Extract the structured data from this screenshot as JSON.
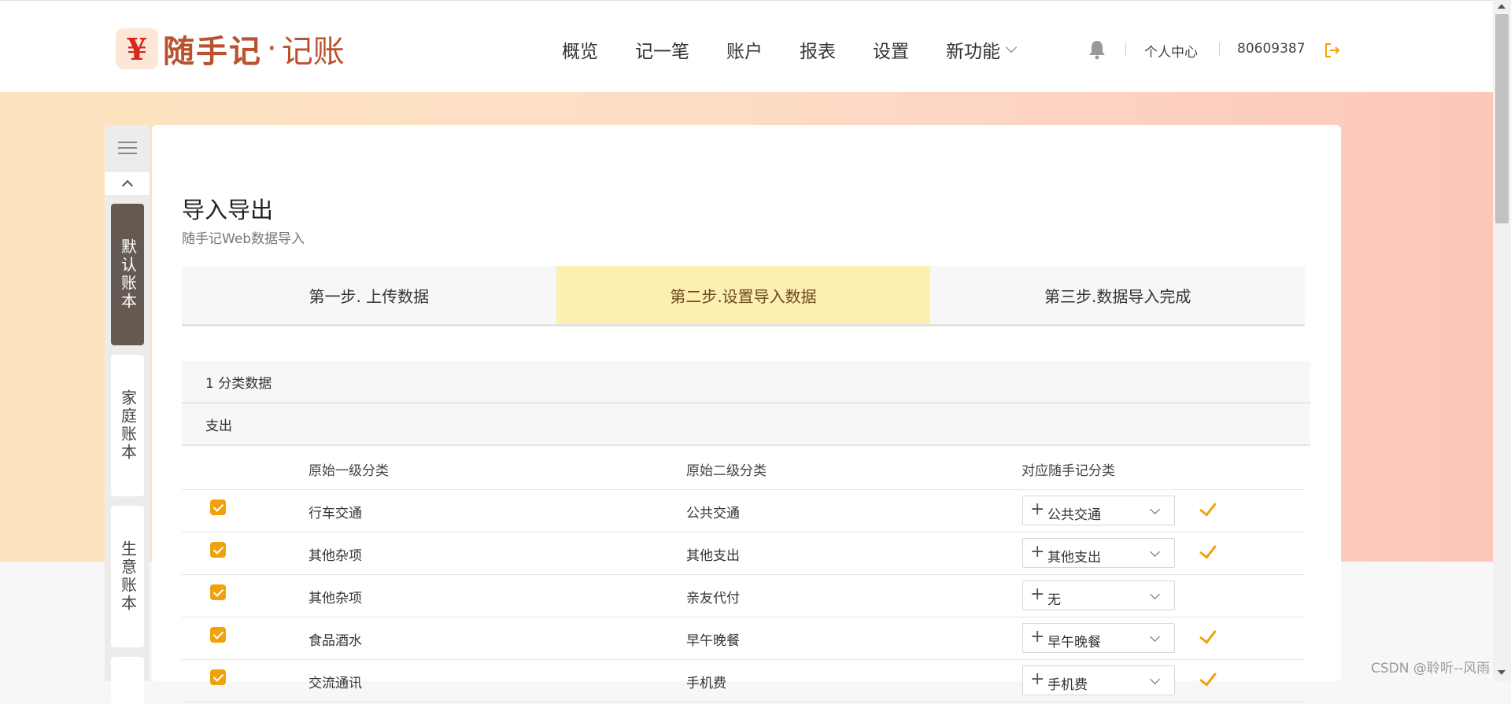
{
  "header": {
    "logo_glyph": "¥",
    "logo_name": "随手记",
    "logo_dot": "·",
    "logo_sub": "记账",
    "nav": [
      "概览",
      "记一笔",
      "账户",
      "报表",
      "设置",
      "新功能"
    ],
    "user_center": "个人中心",
    "user_id": "80609387"
  },
  "sidebar": {
    "books": [
      "默认账本",
      "家庭账本",
      "生意账本"
    ],
    "active_index": 0
  },
  "page": {
    "title": "导入导出",
    "subtitle": "随手记Web数据导入"
  },
  "steps": [
    "第一步. 上传数据",
    "第二步.设置导入数据",
    "第三步.数据导入完成"
  ],
  "active_step": 1,
  "section": {
    "heading": "1 分类数据",
    "type": "支出"
  },
  "table": {
    "headers": [
      "原始一级分类",
      "原始二级分类",
      "对应随手记分类"
    ],
    "rows": [
      {
        "level1": "行车交通",
        "level2": "公共交通",
        "mapped": "公共交通",
        "matched": true
      },
      {
        "level1": "其他杂项",
        "level2": "其他支出",
        "mapped": "其他支出",
        "matched": true
      },
      {
        "level1": "其他杂项",
        "level2": "亲友代付",
        "mapped": "无",
        "matched": false
      },
      {
        "level1": "食品酒水",
        "level2": "早午晚餐",
        "mapped": "早午晚餐",
        "matched": true
      },
      {
        "level1": "交流通讯",
        "level2": "手机费",
        "mapped": "手机费",
        "matched": true
      }
    ]
  },
  "watermark": "CSDN @聆听--风雨",
  "colors": {
    "accent": "#f0a20c",
    "active_step": "#fdeeb1",
    "active_book": "#655a52",
    "brand": "#b9532f"
  }
}
